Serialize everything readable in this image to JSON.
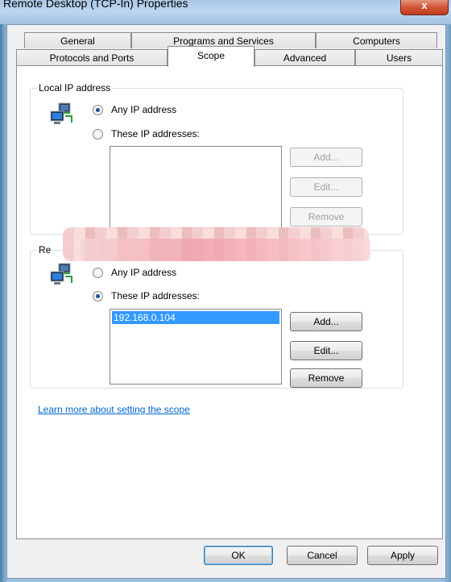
{
  "window": {
    "title": "Remote Desktop (TCP-In) Properties",
    "close_glyph": "x"
  },
  "tabs": {
    "row1": [
      "General",
      "Programs and Services",
      "Computers"
    ],
    "row2": [
      "Protocols and Ports",
      "Scope",
      "Advanced",
      "Users"
    ],
    "active": "Scope"
  },
  "local_ip": {
    "group_label": "Local IP address",
    "option_any": "Any IP address",
    "option_these": "These IP addresses:",
    "selected": "any",
    "items": [],
    "add_label": "Add...",
    "edit_label": "Edit...",
    "remove_label": "Remove"
  },
  "remote_ip": {
    "group_label": "Re",
    "option_any": "Any IP address",
    "option_these": "These IP addresses:",
    "selected": "these",
    "items": [
      "192.168.0.104"
    ],
    "add_label": "Add...",
    "edit_label": "Edit...",
    "remove_label": "Remove"
  },
  "help_link": "Learn more about setting the scope",
  "footer": {
    "ok_label": "OK",
    "cancel_label": "Cancel",
    "apply_label": "Apply"
  },
  "icons": {
    "local": "network-computer-icon",
    "remote": "network-computer-icon"
  }
}
